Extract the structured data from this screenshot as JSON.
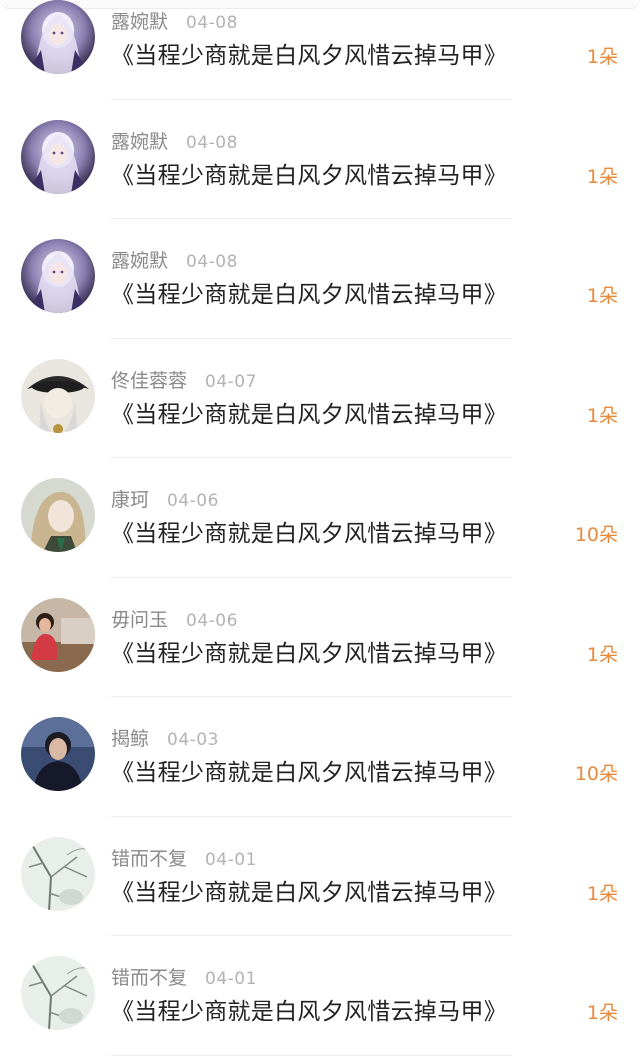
{
  "rows": [
    {
      "name": "露婉默",
      "date": "04-08",
      "title": "《当程少商就是白风夕风惜云掉马甲》",
      "count": "1朵",
      "avatar": "anime-white-hair"
    },
    {
      "name": "露婉默",
      "date": "04-08",
      "title": "《当程少商就是白风夕风惜云掉马甲》",
      "count": "1朵",
      "avatar": "anime-white-hair"
    },
    {
      "name": "露婉默",
      "date": "04-08",
      "title": "《当程少商就是白风夕风惜云掉马甲》",
      "count": "1朵",
      "avatar": "anime-white-hair"
    },
    {
      "name": "佟佳蓉蓉",
      "date": "04-07",
      "title": "《当程少商就是白风夕风惜云掉马甲》",
      "count": "1朵",
      "avatar": "anime-hat"
    },
    {
      "name": "康珂",
      "date": "04-06",
      "title": "《当程少商就是白风夕风惜云掉马甲》",
      "count": "10朵",
      "avatar": "anime-blonde"
    },
    {
      "name": "毋问玉",
      "date": "04-06",
      "title": "《当程少商就是白风夕风惜云掉马甲》",
      "count": "1朵",
      "avatar": "photo-red"
    },
    {
      "name": "揭鲸",
      "date": "04-03",
      "title": "《当程少商就是白风夕风惜云掉马甲》",
      "count": "10朵",
      "avatar": "photo-dark"
    },
    {
      "name": "错而不复",
      "date": "04-01",
      "title": "《当程少商就是白风夕风惜云掉马甲》",
      "count": "1朵",
      "avatar": "sketch-tree"
    },
    {
      "name": "错而不复",
      "date": "04-01",
      "title": "《当程少商就是白风夕风惜云掉马甲》",
      "count": "1朵",
      "avatar": "sketch-tree"
    }
  ],
  "colors": {
    "name": "#8a8a8a",
    "date": "#b3b3b3",
    "title": "#222222",
    "count": "#e88a3c",
    "divider": "#eeeeee"
  }
}
